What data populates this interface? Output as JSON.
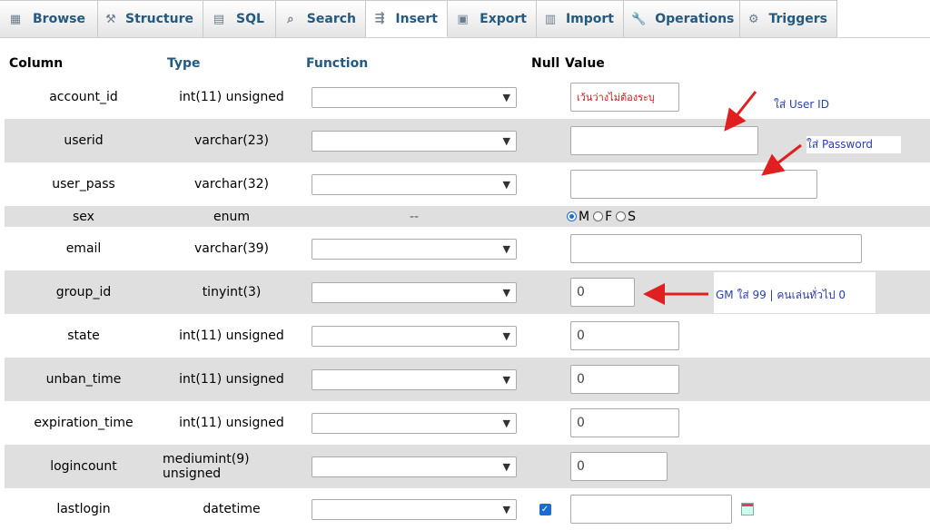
{
  "tabs": [
    {
      "label": "Browse",
      "icon": "browse-icon"
    },
    {
      "label": "Structure",
      "icon": "structure-icon"
    },
    {
      "label": "SQL",
      "icon": "sql-icon"
    },
    {
      "label": "Search",
      "icon": "search-icon"
    },
    {
      "label": "Insert",
      "icon": "insert-icon",
      "active": true
    },
    {
      "label": "Export",
      "icon": "export-icon"
    },
    {
      "label": "Import",
      "icon": "import-icon"
    },
    {
      "label": "Operations",
      "icon": "wrench-icon"
    },
    {
      "label": "Triggers",
      "icon": "triggers-icon"
    }
  ],
  "header": {
    "column": "Column",
    "type": "Type",
    "function": "Function",
    "null": "Null",
    "value": "Value"
  },
  "rows": [
    {
      "name": "account_id",
      "type": "int(11) unsigned",
      "value": "เว้นว่างไม่ต้องระบุ"
    },
    {
      "name": "userid",
      "type": "varchar(23)",
      "value": ""
    },
    {
      "name": "user_pass",
      "type": "varchar(32)",
      "value": ""
    },
    {
      "name": "sex",
      "type": "enum",
      "function_text": "--",
      "options": [
        "M",
        "F",
        "S"
      ],
      "selected": "M"
    },
    {
      "name": "email",
      "type": "varchar(39)",
      "value": ""
    },
    {
      "name": "group_id",
      "type": "tinyint(3)",
      "value": "0"
    },
    {
      "name": "state",
      "type": "int(11) unsigned",
      "value": "0"
    },
    {
      "name": "unban_time",
      "type": "int(11) unsigned",
      "value": "0"
    },
    {
      "name": "expiration_time",
      "type": "int(11) unsigned",
      "value": "0"
    },
    {
      "name": "logincount",
      "type": "mediumint(9) unsigned",
      "value": "0"
    },
    {
      "name": "lastlogin",
      "type": "datetime",
      "value": "",
      "null_checked": true
    }
  ],
  "annotations": {
    "user_id": "ใส่ User ID",
    "password": "ใส่ Password",
    "group": "GM ใส่ 99 | คนเล่นทั่วไป 0"
  },
  "colors": {
    "accent": "#235a81",
    "arrow": "#e02020",
    "note": "#2b3fae",
    "row_alt": "#dfdfdf"
  }
}
